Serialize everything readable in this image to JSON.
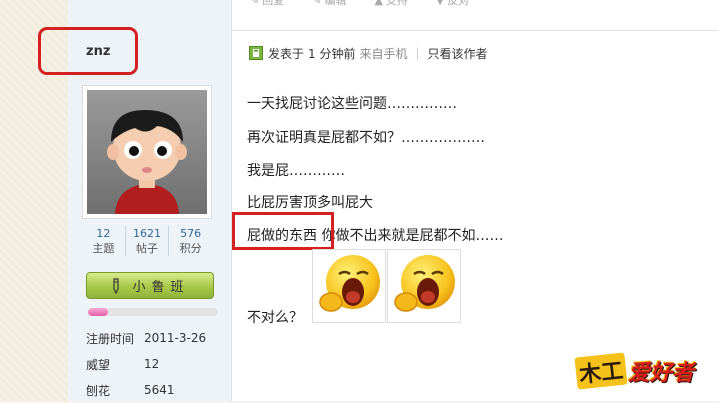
{
  "top_actions": [
    "回复",
    "编辑",
    "支持",
    "反对"
  ],
  "user": {
    "name": "znz",
    "stats": [
      {
        "value": "12",
        "label": "主题"
      },
      {
        "value": "1621",
        "label": "帖子"
      },
      {
        "value": "576",
        "label": "积分"
      }
    ],
    "rank": "小鲁班",
    "rank_progress": 0.15,
    "info": [
      {
        "key": "注册时间",
        "value": "2011-3-26"
      },
      {
        "key": "威望",
        "value": "12"
      },
      {
        "key": "刨花",
        "value": "5641"
      }
    ]
  },
  "post": {
    "posted_label": "发表于",
    "posted_time": "1 分钟前",
    "source": "来自手机",
    "author_only_link": "只看该作者",
    "lines": [
      "一天找屁讨论这些问题……………",
      "再次证明真是屁都不如？………………",
      "我是屁…………",
      "比屁厉害顶多叫屁大",
      "屁做的东西 你做不出来就是屁都不如……"
    ],
    "last_line": "不对么？"
  },
  "watermark": {
    "boxed": "木工",
    "text": "爱好者"
  },
  "colors": {
    "highlight": "#d32020",
    "rank_button": "#a8c848",
    "progress": "#e060a8"
  }
}
